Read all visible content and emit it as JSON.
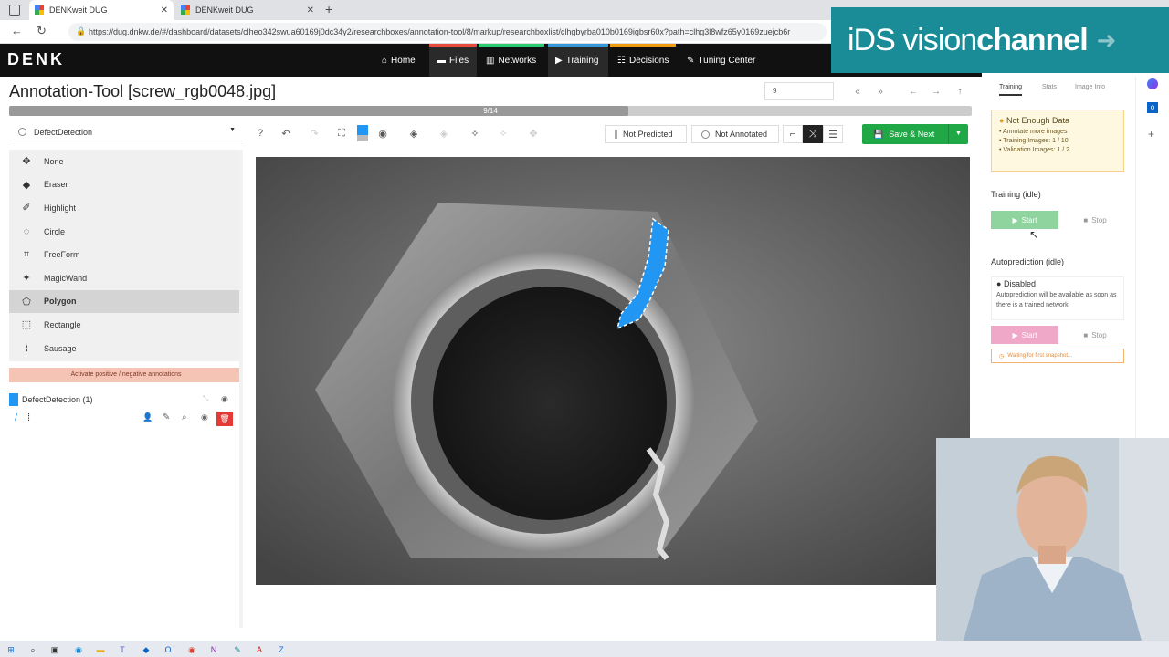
{
  "browser": {
    "tabs": [
      {
        "label": "DENKweit DUG",
        "active": true
      },
      {
        "label": "DENKweit DUG",
        "active": false
      }
    ],
    "new_tab": "+",
    "url": "https://dug.dnkw.de/#/dashboard/datasets/clheo342swua60169j0dc34y2/researchboxes/annotation-tool/8/markup/researchboxlist/clhgbyrba010b0169igbsr60x?path=clhg3l8wfz65y0169zuejcb6r"
  },
  "app": {
    "logo": "DENK",
    "nav": [
      {
        "label": "Home",
        "icon": "⌂",
        "color": ""
      },
      {
        "label": "Files",
        "icon": "▬",
        "color": "#e74c3c"
      },
      {
        "label": "Networks",
        "icon": "▥",
        "color": "#2ecc71"
      },
      {
        "label": "Training",
        "icon": "▶",
        "color": "#3498db"
      },
      {
        "label": "Decisions",
        "icon": "☷",
        "color": "#f39c12"
      },
      {
        "label": "Tuning Center",
        "icon": "✎",
        "color": ""
      }
    ]
  },
  "overlay": {
    "brand_light": "iDS vision",
    "brand_bold": "channel"
  },
  "toolbar": {
    "title": "Annotation-Tool [screw_rgb0048.jpg]",
    "progress_text": "9/14",
    "progress_fraction": 0.643,
    "image_number": "9",
    "not_predicted": "Not Predicted",
    "not_annotated": "Not Annotated",
    "save_next": "Save & Next"
  },
  "class_select": {
    "value": "DefectDetection"
  },
  "tools": [
    {
      "label": "None",
      "icon": "✥"
    },
    {
      "label": "Eraser",
      "icon": "◆"
    },
    {
      "label": "Highlight",
      "icon": "✐"
    },
    {
      "label": "Circle",
      "icon": "◌"
    },
    {
      "label": "FreeForm",
      "icon": "⌗"
    },
    {
      "label": "MagicWand",
      "icon": "✦"
    },
    {
      "label": "Polygon",
      "icon": "⬠"
    },
    {
      "label": "Rectangle",
      "icon": "⬚"
    },
    {
      "label": "Sausage",
      "icon": "⌇"
    }
  ],
  "selected_tool": "Polygon",
  "activate_label": "Activate positive / negative annotations",
  "class_entry": {
    "label": "DefectDetection (1)",
    "color": "#2196f3"
  },
  "right_panel": {
    "tabs": [
      "Training",
      "Stats",
      "Image Info"
    ],
    "warning_title": "Not Enough Data",
    "warning_items": [
      "Annotate more images",
      "Training Images: 1 / 10",
      "Validation Images: 1 / 2"
    ],
    "training_title": "Training (idle)",
    "start": "Start",
    "stop": "Stop",
    "autopred_title": "Autoprediction (idle)",
    "disabled_title": "Disabled",
    "disabled_text": "Autoprediction will be available as soon as there is a trained network",
    "waiting": "Waiting for first snapshot..."
  },
  "colors": {
    "accent_green": "#1fa845",
    "start_green": "#8fd49f",
    "start_pink": "#f0a8c8",
    "annotation_blue": "#2196f3"
  }
}
